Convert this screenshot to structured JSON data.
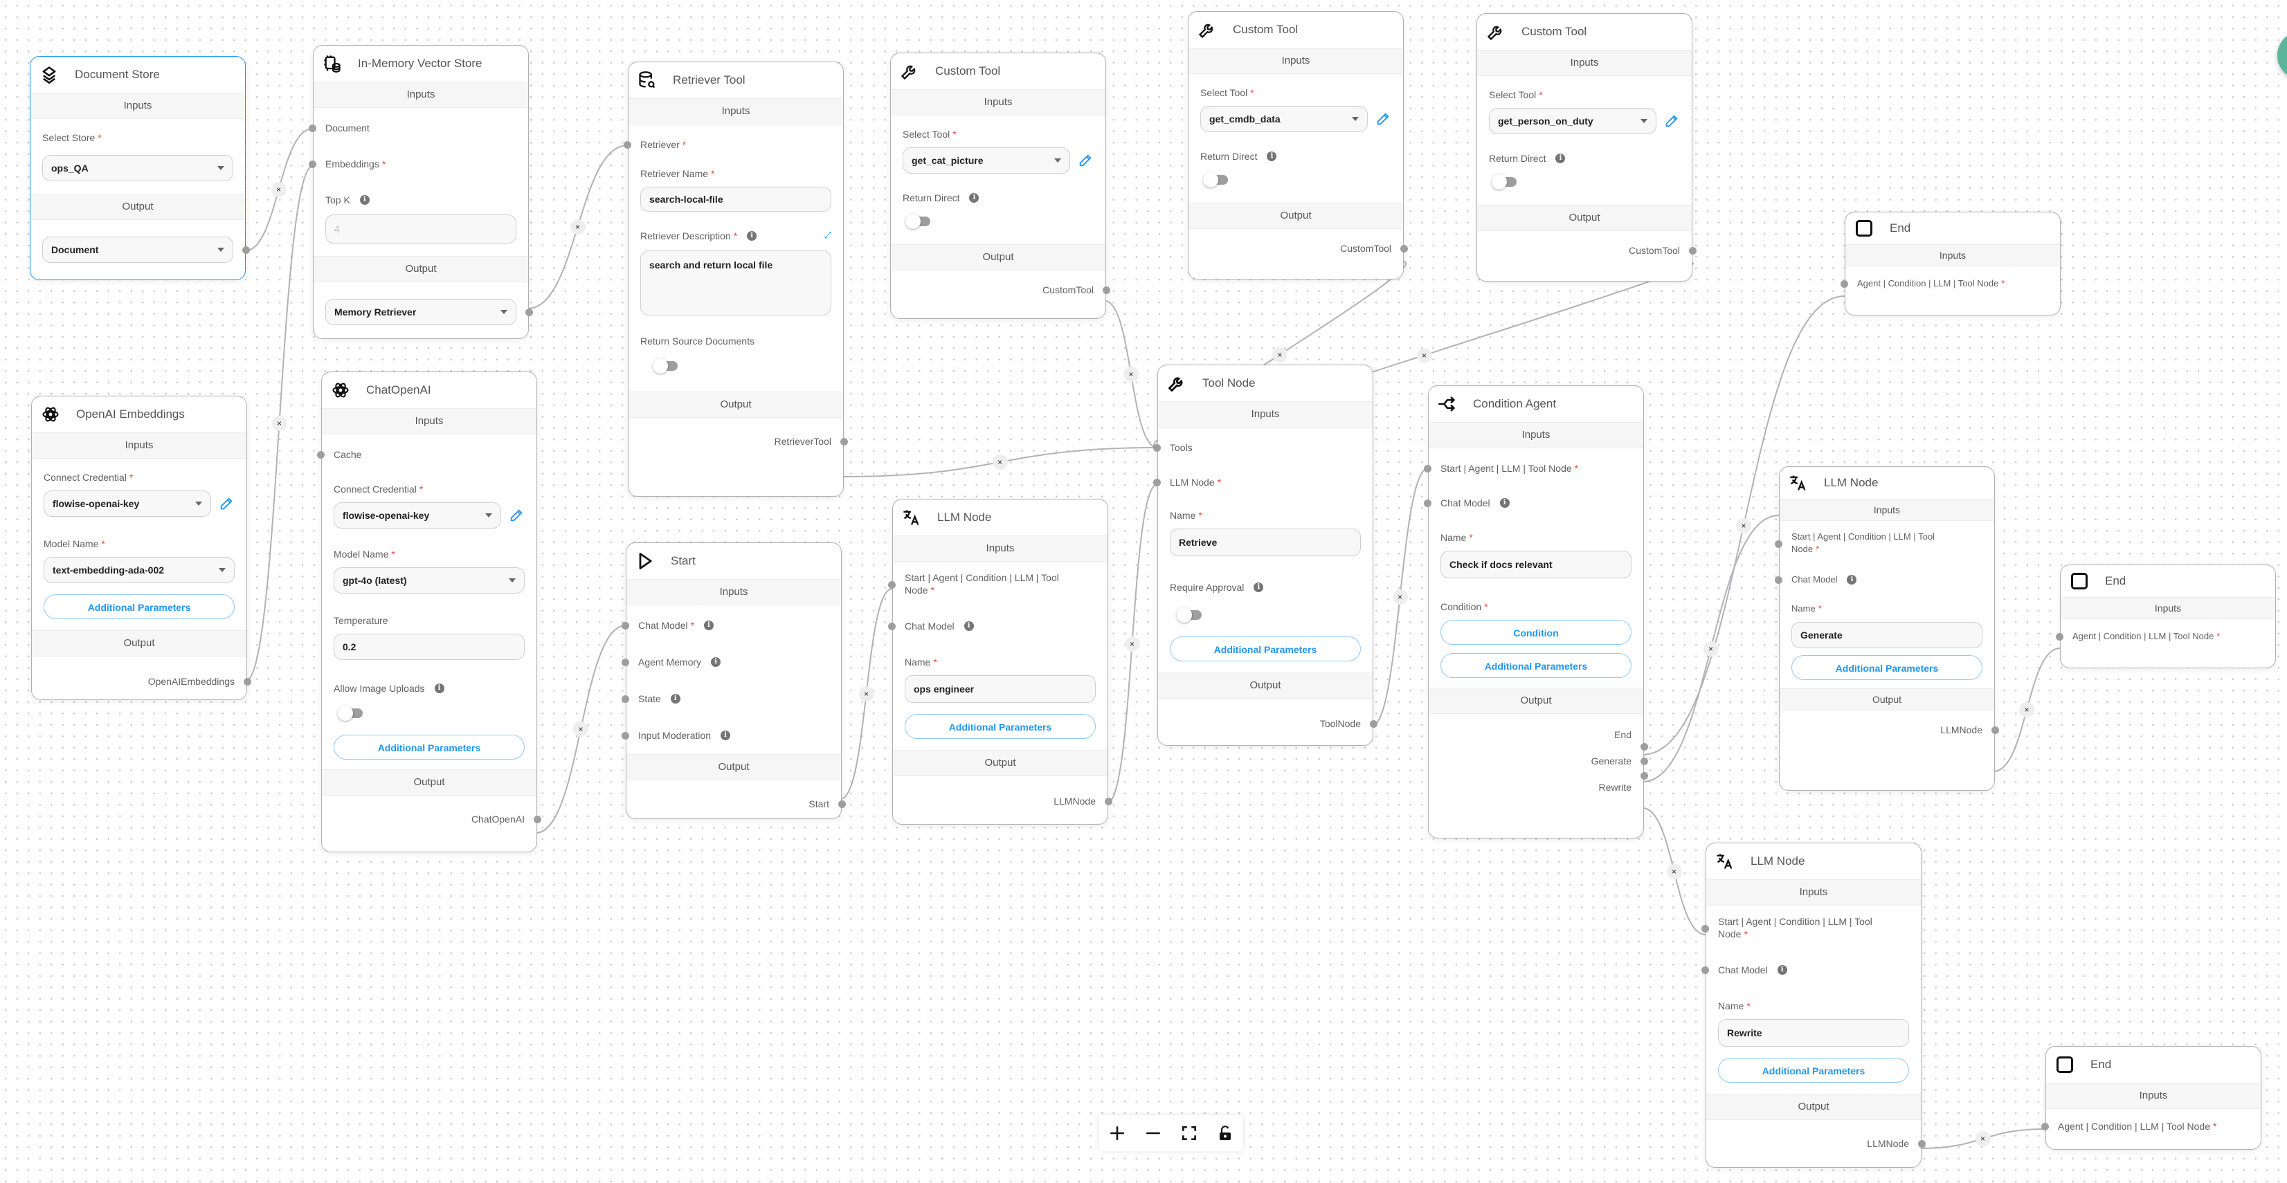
{
  "canvas": {
    "accent_color": "#2196f3",
    "required_color": "#f44336",
    "edge_color": "#b1b1b7",
    "edge_delete_label": "×"
  },
  "labels": {
    "inputs": "Inputs",
    "output": "Output",
    "additional_parameters": "Additional Parameters",
    "required_mark": "*",
    "info_mark": "i"
  },
  "nodes": {
    "document_store": {
      "title": "Document Store",
      "icon": "layers-icon",
      "select_store_label": "Select Store",
      "select_store_value": "ops_QA",
      "output_value": "Document"
    },
    "vector_store": {
      "title": "In-Memory Vector Store",
      "icon": "vector-store-icon",
      "document_label": "Document",
      "embeddings_label": "Embeddings",
      "topk_label": "Top K",
      "topk_placeholder": "4",
      "output_value": "Memory Retriever"
    },
    "retriever_tool": {
      "title": "Retriever Tool",
      "icon": "database-search-icon",
      "retriever_label": "Retriever",
      "name_label": "Retriever Name",
      "name_value": "search-local-file",
      "description_label": "Retriever Description",
      "description_value": "search and return local file",
      "return_source_label": "Return Source Documents",
      "return_source_on": false,
      "output_label": "RetrieverTool"
    },
    "custom_tool_1": {
      "title": "Custom Tool",
      "icon": "wrench-icon",
      "select_tool_label": "Select Tool",
      "select_tool_value": "get_cat_picture",
      "return_direct_label": "Return Direct",
      "return_direct_on": false,
      "output_label": "CustomTool"
    },
    "custom_tool_2": {
      "title": "Custom Tool",
      "icon": "wrench-icon",
      "select_tool_label": "Select Tool",
      "select_tool_value": "get_cmdb_data",
      "return_direct_label": "Return Direct",
      "return_direct_on": false,
      "output_label": "CustomTool"
    },
    "custom_tool_3": {
      "title": "Custom Tool",
      "icon": "wrench-icon",
      "select_tool_label": "Select Tool",
      "select_tool_value": "get_person_on_duty",
      "return_direct_label": "Return Direct",
      "return_direct_on": false,
      "output_label": "CustomTool"
    },
    "openai_embeddings": {
      "title": "OpenAI Embeddings",
      "icon": "openai-icon",
      "credential_label": "Connect Credential",
      "credential_value": "flowise-openai-key",
      "model_label": "Model Name",
      "model_value": "text-embedding-ada-002",
      "output_label": "OpenAIEmbeddings"
    },
    "chat_openai": {
      "title": "ChatOpenAI",
      "icon": "openai-icon",
      "cache_label": "Cache",
      "credential_label": "Connect Credential",
      "credential_value": "flowise-openai-key",
      "model_label": "Model Name",
      "model_value": "gpt-4o (latest)",
      "temperature_label": "Temperature",
      "temperature_value": "0.2",
      "image_uploads_label": "Allow Image Uploads",
      "image_uploads_on": false,
      "output_label": "ChatOpenAI"
    },
    "start": {
      "title": "Start",
      "icon": "play-icon",
      "chat_model_label": "Chat Model",
      "agent_memory_label": "Agent Memory",
      "state_label": "State",
      "input_moderation_label": "Input Moderation",
      "output_label": "Start"
    },
    "llm_node_1": {
      "title": "LLM Node",
      "icon": "translate-icon",
      "input_label": "Start | Agent | Condition | LLM | Tool Node",
      "chat_model_label": "Chat Model",
      "name_label": "Name",
      "name_value": "ops engineer",
      "output_label": "LLMNode"
    },
    "tool_node": {
      "title": "Tool Node",
      "icon": "wrench-icon",
      "tools_label": "Tools",
      "llm_node_label": "LLM Node",
      "name_label": "Name",
      "name_value": "Retrieve",
      "require_approval_label": "Require Approval",
      "require_approval_on": false,
      "output_label": "ToolNode"
    },
    "condition_agent": {
      "title": "Condition Agent",
      "icon": "split-arrow-icon",
      "input_label": "Start | Agent | LLM | Tool Node",
      "chat_model_label": "Chat Model",
      "name_label": "Name",
      "name_value": "Check if docs relevant",
      "condition_label": "Condition",
      "condition_button": "Condition",
      "outputs": [
        "End",
        "Generate",
        "Rewrite"
      ]
    },
    "end_1": {
      "title": "End",
      "icon": "square-icon",
      "input_label": "Agent | Condition | LLM | Tool Node"
    },
    "llm_node_2": {
      "title": "LLM Node",
      "icon": "translate-icon",
      "input_label": "Start | Agent | Condition | LLM | Tool Node",
      "chat_model_label": "Chat Model",
      "name_label": "Name",
      "name_value": "Generate",
      "output_label": "LLMNode"
    },
    "end_2": {
      "title": "End",
      "icon": "square-icon",
      "input_label": "Agent | Condition | LLM | Tool Node"
    },
    "llm_node_3": {
      "title": "LLM Node",
      "icon": "translate-icon",
      "input_label": "Start | Agent | Condition | LLM | Tool Node",
      "chat_model_label": "Chat Model",
      "name_label": "Name",
      "name_value": "Rewrite",
      "output_label": "LLMNode"
    },
    "end_3": {
      "title": "End",
      "icon": "square-icon",
      "input_label": "Agent | Condition | LLM | Tool Node"
    }
  },
  "controls": {
    "zoom_in": "zoom-in-icon",
    "zoom_out": "zoom-out-icon",
    "fit_view": "fit-view-icon",
    "lock": "unlock-icon"
  }
}
